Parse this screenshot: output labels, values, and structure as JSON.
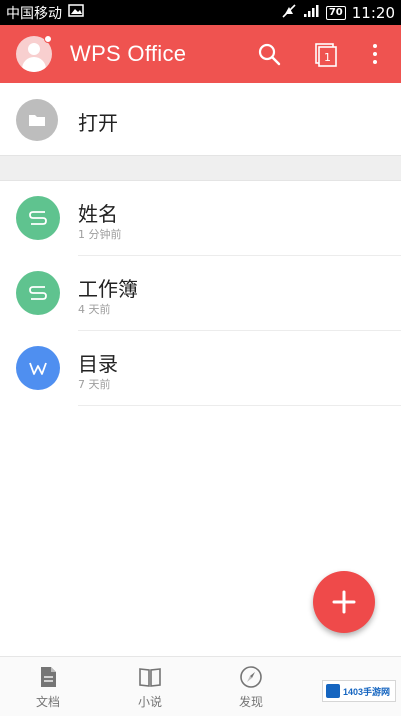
{
  "status_bar": {
    "carrier": "中国移动",
    "battery": "70",
    "time": "11:20",
    "icons": [
      "image-icon",
      "mute-icon",
      "signal-icon",
      "battery-icon"
    ]
  },
  "app_bar": {
    "title": "WPS Office",
    "background_color": "#ef5350",
    "icons": [
      "avatar-icon",
      "search-icon",
      "tabs-icon",
      "more-icon"
    ],
    "tab_count": "1"
  },
  "open_entry": {
    "label": "打开",
    "icon": "folder-icon"
  },
  "files": [
    {
      "name": "姓名",
      "time": "1 分钟前",
      "type": "S",
      "icon": "spreadsheet-icon",
      "color": "#5fc38f"
    },
    {
      "name": "工作簿",
      "time": "4 天前",
      "type": "S",
      "icon": "spreadsheet-icon",
      "color": "#5fc38f"
    },
    {
      "name": "目录",
      "time": "7 天前",
      "type": "W",
      "icon": "document-icon",
      "color": "#4f8ff0"
    }
  ],
  "fab": {
    "icon": "plus-icon",
    "color": "#ef4a4a"
  },
  "bottom_nav": {
    "items": [
      {
        "label": "文档",
        "icon": "document-icon"
      },
      {
        "label": "小说",
        "icon": "book-icon"
      },
      {
        "label": "发现",
        "icon": "compass-icon"
      }
    ]
  },
  "watermark": {
    "text": "1403手游网"
  }
}
